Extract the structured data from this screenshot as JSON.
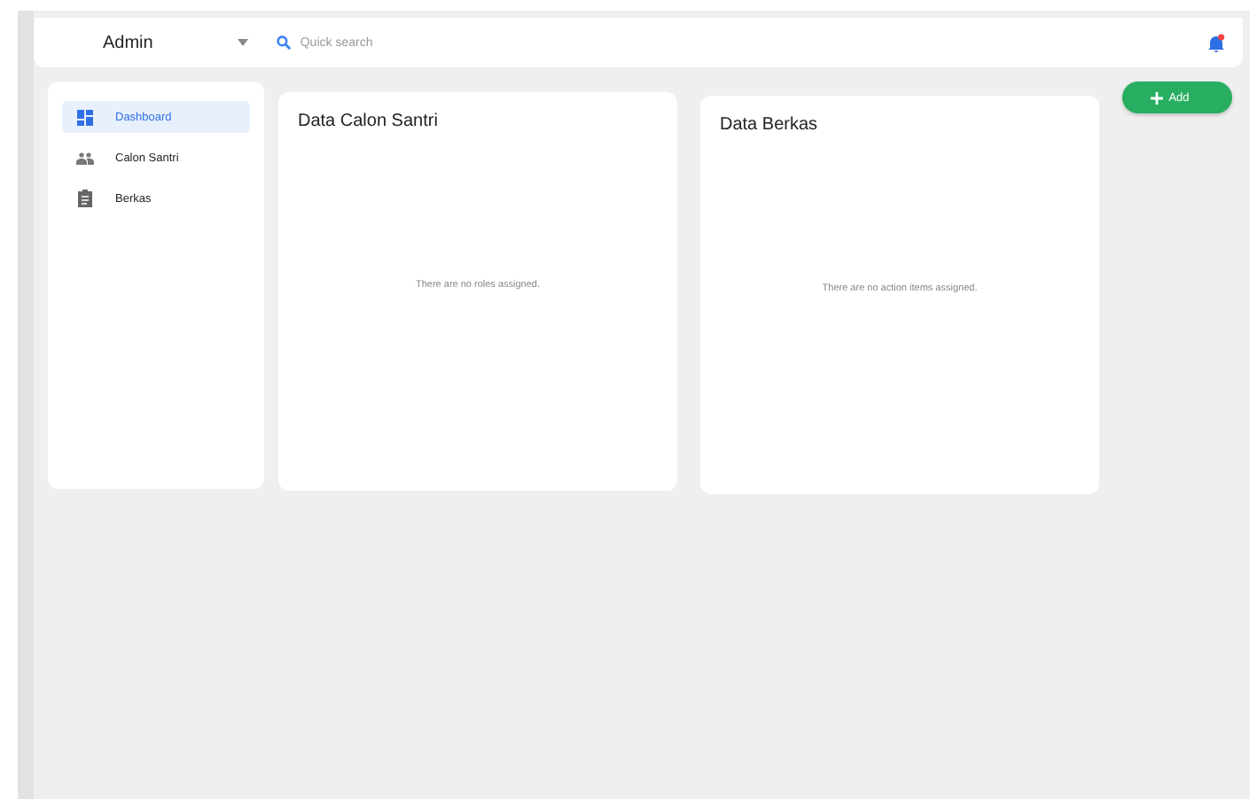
{
  "topbar": {
    "user": "Admin",
    "search": {
      "placeholder": "Quick search"
    },
    "has_notification": true
  },
  "sidebar": {
    "items": [
      {
        "label": "Dashboard",
        "kind": "grid",
        "selected": true
      },
      {
        "label": "Calon Santri",
        "kind": "people",
        "selected": false
      },
      {
        "label": "Berkas",
        "kind": "clipboard",
        "selected": false
      }
    ]
  },
  "cards": [
    {
      "title": "Data Calon Santri",
      "empty_message": "There are no roles assigned."
    },
    {
      "title": "Data Berkas",
      "empty_message": "There are no action items assigned."
    }
  ],
  "add_button": {
    "label": "Add"
  }
}
